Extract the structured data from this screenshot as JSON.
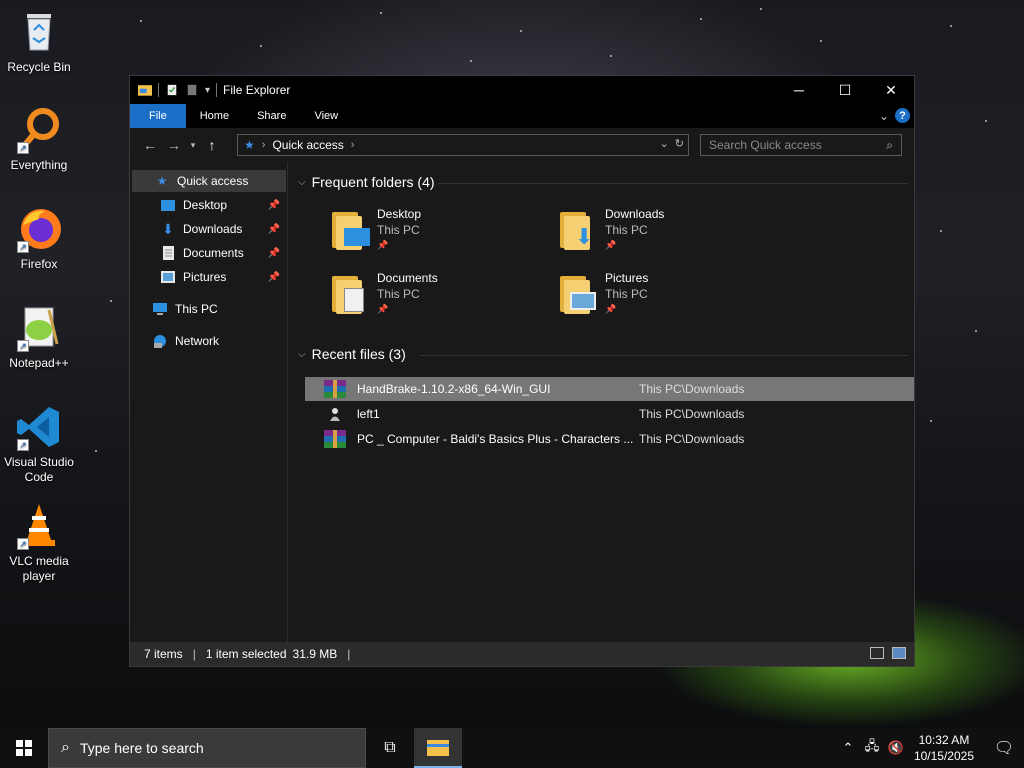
{
  "desktop": {
    "icons": [
      {
        "label": "Recycle Bin",
        "icon": "recycle-bin-icon"
      },
      {
        "label": "Everything",
        "icon": "everything-search-icon"
      },
      {
        "label": "Firefox",
        "icon": "firefox-icon"
      },
      {
        "label": "Notepad++",
        "icon": "notepad-plus-plus-icon"
      },
      {
        "label": "Visual Studio Code",
        "icon": "vscode-icon"
      },
      {
        "label": "VLC media player",
        "icon": "vlc-icon"
      }
    ]
  },
  "window": {
    "title": "File Explorer",
    "ribbon_tabs": [
      "File",
      "Home",
      "Share",
      "View"
    ],
    "address": {
      "location": "Quick access"
    },
    "search": {
      "placeholder": "Search Quick access"
    },
    "controls": {
      "minimize": "─",
      "maximize": "☐",
      "close": "✕"
    }
  },
  "navigation": {
    "items": [
      {
        "label": "Quick access",
        "icon": "star-icon",
        "pinned": false,
        "selected": true
      },
      {
        "label": "Desktop",
        "icon": "desktop-icon",
        "pinned": true
      },
      {
        "label": "Downloads",
        "icon": "download-arrow-icon",
        "pinned": true
      },
      {
        "label": "Documents",
        "icon": "document-icon",
        "pinned": true
      },
      {
        "label": "Pictures",
        "icon": "pictures-icon",
        "pinned": true
      },
      {
        "label": "This PC",
        "icon": "computer-icon"
      },
      {
        "label": "Network",
        "icon": "network-icon"
      }
    ]
  },
  "frequent": {
    "header": "Frequent folders (4)",
    "folders": [
      {
        "name": "Desktop",
        "location": "This PC"
      },
      {
        "name": "Downloads",
        "location": "This PC"
      },
      {
        "name": "Documents",
        "location": "This PC"
      },
      {
        "name": "Pictures",
        "location": "This PC"
      }
    ]
  },
  "recent": {
    "header": "Recent files (3)",
    "files": [
      {
        "name": "HandBrake-1.10.2-x86_64-Win_GUI",
        "location": "This PC\\Downloads",
        "selected": true,
        "icon": "winrar-archive-icon"
      },
      {
        "name": "left1",
        "location": "This PC\\Downloads",
        "selected": false,
        "icon": "generic-file-icon"
      },
      {
        "name": "PC _ Computer - Baldi's Basics Plus - Characters ...",
        "location": "This PC\\Downloads",
        "selected": false,
        "icon": "winrar-archive-icon"
      }
    ]
  },
  "status": {
    "items": "7 items",
    "selection": "1 item selected",
    "size": "31.9 MB"
  },
  "taskbar": {
    "search_placeholder": "Type here to search",
    "time": "10:32 AM",
    "date": "10/15/2025"
  },
  "colors": {
    "accent": "#1b6fc6",
    "window_bg": "#191919",
    "selected_row": "#777777",
    "folder": "#f4d073"
  }
}
